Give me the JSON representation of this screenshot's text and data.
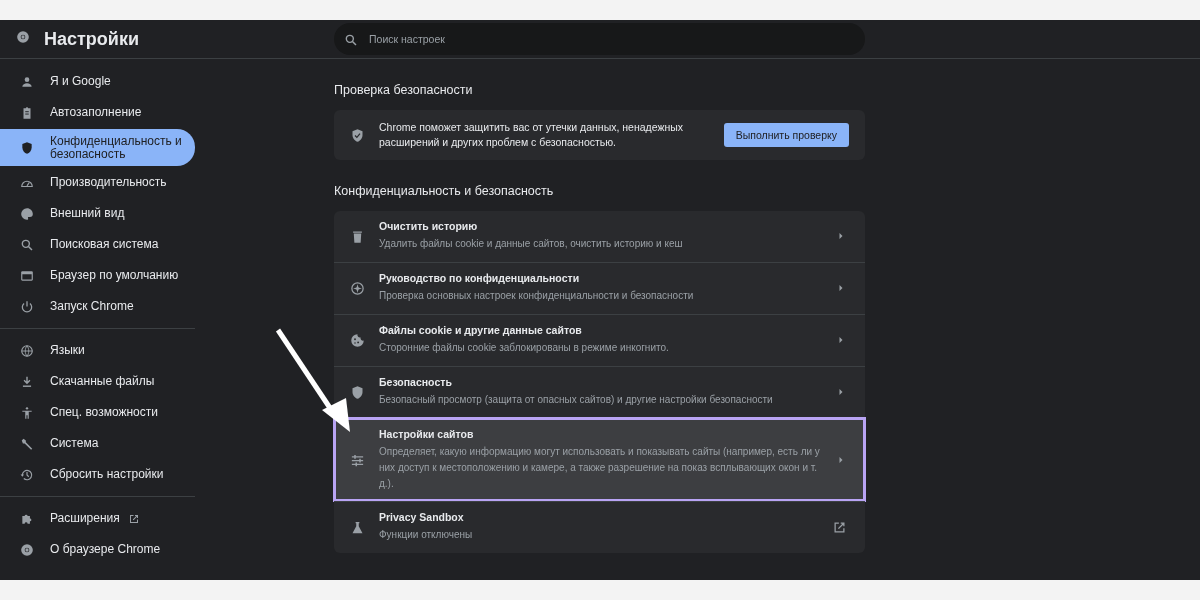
{
  "header": {
    "title": "Настройки"
  },
  "search": {
    "placeholder": "Поиск настроек"
  },
  "sidebar": {
    "groups": [
      {
        "items": [
          {
            "kind": "person",
            "label": "Я и Google",
            "selected": false,
            "external": false
          },
          {
            "kind": "clipboard",
            "label": "Автозаполнение",
            "selected": false,
            "external": false
          },
          {
            "kind": "shield",
            "label": "Конфиденциальность и безопасность",
            "selected": true,
            "external": false
          },
          {
            "kind": "gauge",
            "label": "Производительность",
            "selected": false,
            "external": false
          },
          {
            "kind": "palette",
            "label": "Внешний вид",
            "selected": false,
            "external": false
          },
          {
            "kind": "search",
            "label": "Поисковая система",
            "selected": false,
            "external": false
          },
          {
            "kind": "window",
            "label": "Браузер по умолчанию",
            "selected": false,
            "external": false
          },
          {
            "kind": "power",
            "label": "Запуск Chrome",
            "selected": false,
            "external": false
          }
        ]
      },
      {
        "items": [
          {
            "kind": "globe",
            "label": "Языки",
            "selected": false,
            "external": false
          },
          {
            "kind": "download",
            "label": "Скачанные файлы",
            "selected": false,
            "external": false
          },
          {
            "kind": "accessibility",
            "label": "Спец. возможности",
            "selected": false,
            "external": false
          },
          {
            "kind": "wrench",
            "label": "Система",
            "selected": false,
            "external": false
          },
          {
            "kind": "history",
            "label": "Сбросить настройки",
            "selected": false,
            "external": false
          }
        ]
      },
      {
        "items": [
          {
            "kind": "puzzle",
            "label": "Расширения",
            "selected": false,
            "external": true
          },
          {
            "kind": "logo",
            "label": "О браузере Chrome",
            "selected": false,
            "external": false
          }
        ]
      }
    ]
  },
  "safety_check": {
    "heading": "Проверка безопасности",
    "text": "Chrome поможет защитить вас от утечки данных, ненадежных расширений и других проблем с безопасностью.",
    "button": "Выполнить проверку"
  },
  "privacy": {
    "heading": "Конфиденциальность и безопасность",
    "rows": [
      {
        "kind": "trash",
        "title": "Очистить историю",
        "subtitle": "Удалить файлы cookie и данные сайтов, очистить историю и кеш",
        "external": false,
        "highlighted": false
      },
      {
        "kind": "compass",
        "title": "Руководство по конфиденциальности",
        "subtitle": "Проверка основных настроек конфиденциальности и безопасности",
        "external": false,
        "highlighted": false
      },
      {
        "kind": "cookie",
        "title": "Файлы cookie и другие данные сайтов",
        "subtitle": "Сторонние файлы cookie заблокированы в режиме инкогнито.",
        "external": false,
        "highlighted": false
      },
      {
        "kind": "shield",
        "title": "Безопасность",
        "subtitle": "Безопасный просмотр (защита от опасных сайтов) и другие настройки безопасности",
        "external": false,
        "highlighted": false
      },
      {
        "kind": "sliders",
        "title": "Настройки сайтов",
        "subtitle": "Определяет, какую информацию могут использовать и показывать сайты (например, есть ли у них доступ к местоположению и камере, а также разрешение на показ всплывающих окон и т. д.).",
        "external": false,
        "highlighted": true
      },
      {
        "kind": "flask",
        "title": "Privacy Sandbox",
        "subtitle": "Функции отключены",
        "external": true,
        "highlighted": false
      }
    ]
  },
  "annotation_arrow": true
}
